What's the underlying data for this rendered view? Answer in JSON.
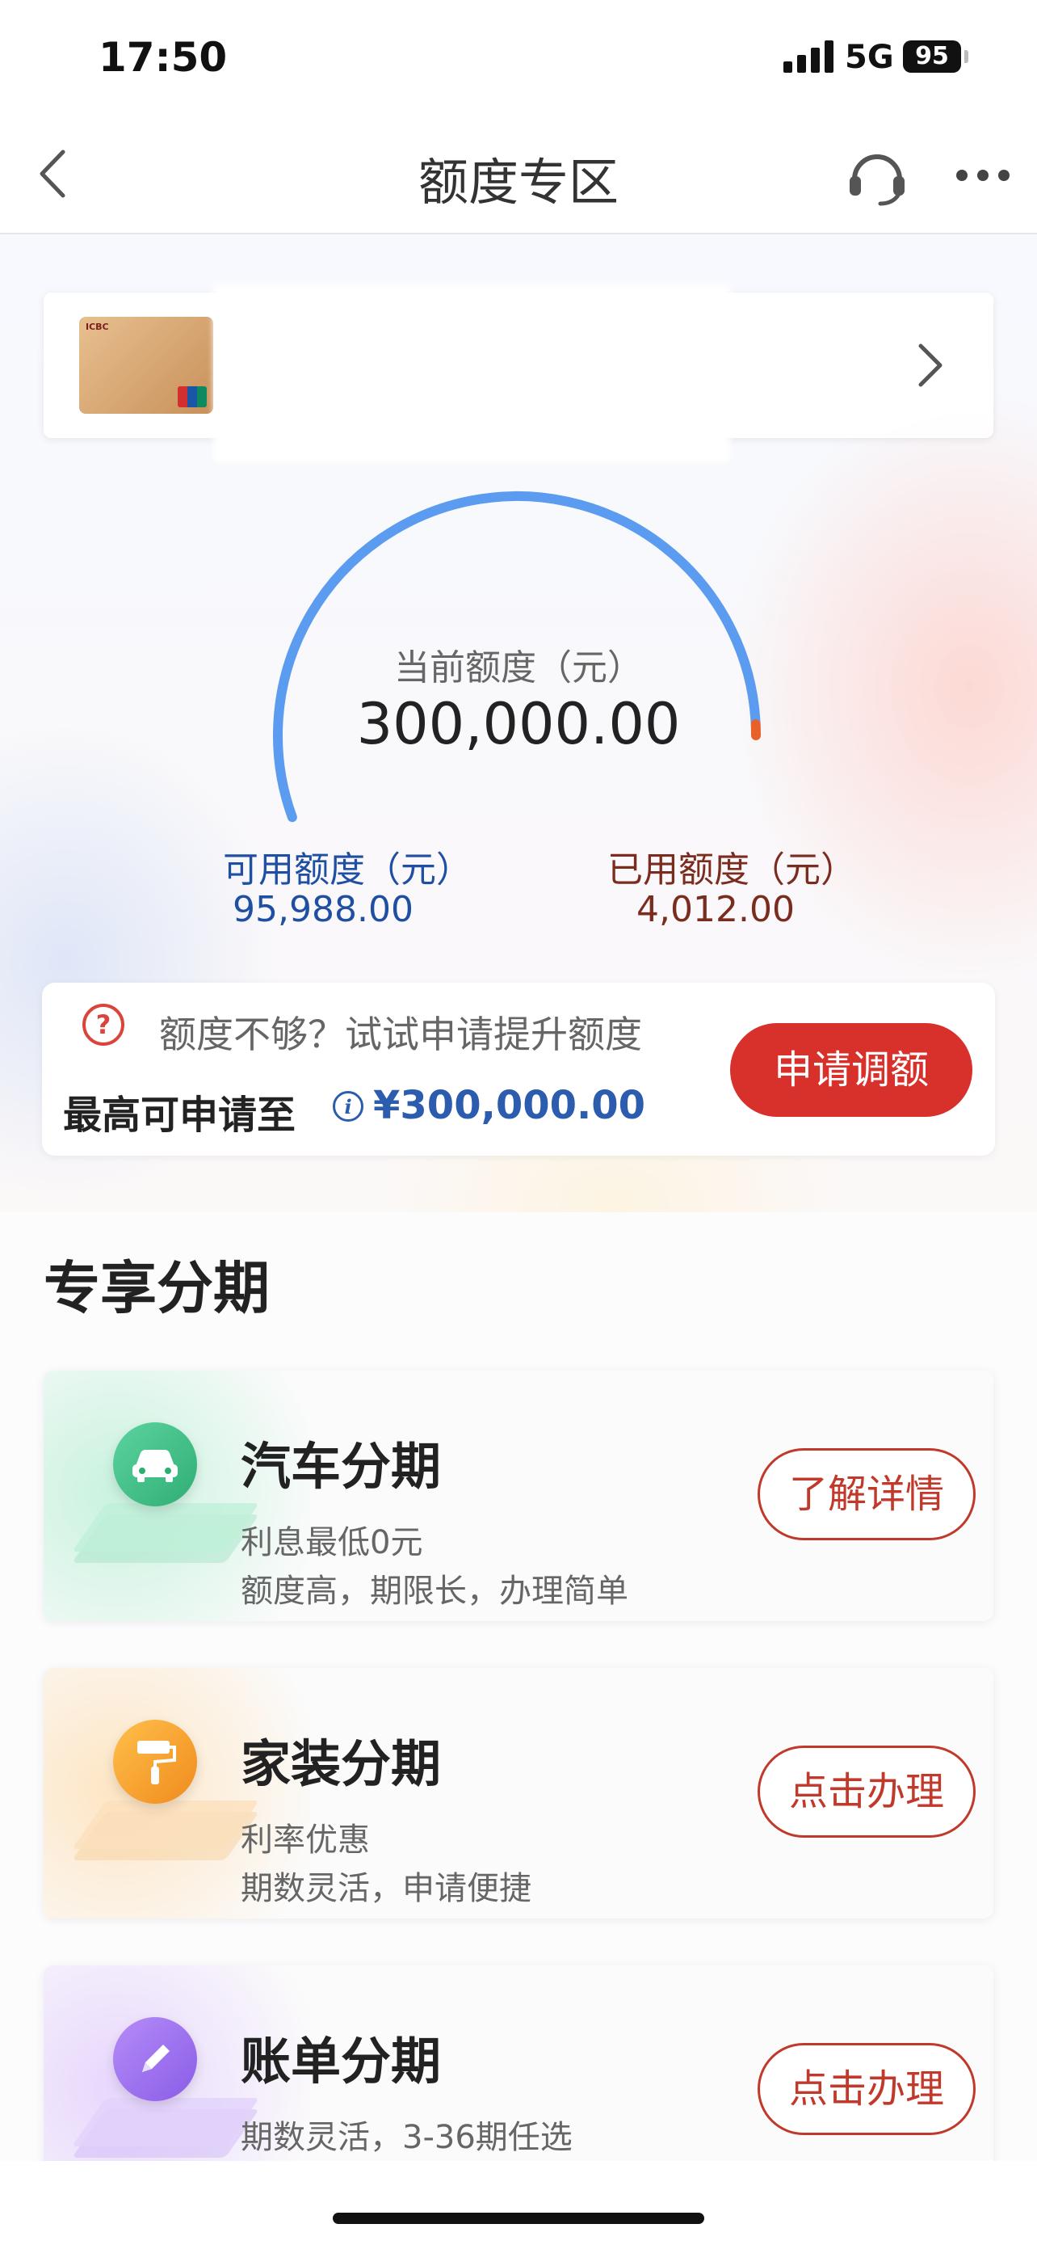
{
  "status_bar": {
    "time": "17:50",
    "network": "5G",
    "battery": "95"
  },
  "nav": {
    "title": "额度专区"
  },
  "credit": {
    "current_label": "当前额度（元）",
    "current_value": "300,000.00",
    "available_label": "可用额度（元）",
    "available_value": "95,988.00",
    "used_label": "已用额度（元）",
    "used_value": "4,012.00",
    "gauge_used_fraction": 0.0134,
    "colors": {
      "available": "#5b9cf0",
      "used": "#e8602c"
    }
  },
  "raise": {
    "hint": "额度不够？试试申请提升额度",
    "max_label": "最高可申请至",
    "max_value": "¥300,000.00",
    "button_label": "申请调额"
  },
  "section": {
    "title": "专享分期"
  },
  "products": [
    {
      "name": "汽车分期",
      "line1": "利息最低0元",
      "line2": "额度高，期限长，办理简单",
      "button": "了解详情",
      "icon": "car-icon",
      "color": "#3cbf86"
    },
    {
      "name": "家装分期",
      "line1": "利率优惠",
      "line2": "期数灵活，申请便捷",
      "button": "点击办理",
      "icon": "paint-roller-icon",
      "color": "#f29a24"
    },
    {
      "name": "账单分期",
      "line1": "期数灵活，3-36期任选",
      "line2": "",
      "button": "点击办理",
      "icon": "pencil-icon",
      "color": "#9b6bf0"
    }
  ]
}
